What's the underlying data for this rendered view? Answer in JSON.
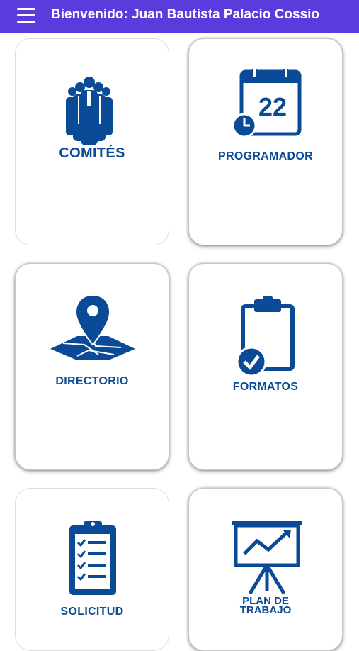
{
  "header": {
    "menu_icon": "hamburger-menu-icon",
    "title": "Bienvenido: Juan Bautista Palacio Cossio",
    "background_color": "#5b3bdc"
  },
  "tiles": [
    {
      "id": "comites",
      "label": "COMITÉS",
      "icon": "committee-people-icon"
    },
    {
      "id": "programador",
      "label": "PROGRAMADOR",
      "icon": "calendar-clock-icon",
      "calendar_day": "22"
    },
    {
      "id": "directorio",
      "label": "DIRECTORIO",
      "icon": "map-pin-icon"
    },
    {
      "id": "formatos",
      "label": "FORMATOS",
      "icon": "clipboard-check-icon"
    },
    {
      "id": "solicitud",
      "label": "SOLICITUD",
      "icon": "checklist-clipboard-icon"
    },
    {
      "id": "plan",
      "label": "PLAN DE TRABAJO",
      "label_line1": "PLAN DE",
      "label_line2": "TRABAJO",
      "icon": "presentation-chart-icon"
    }
  ],
  "accent_color": "#0b4a96"
}
